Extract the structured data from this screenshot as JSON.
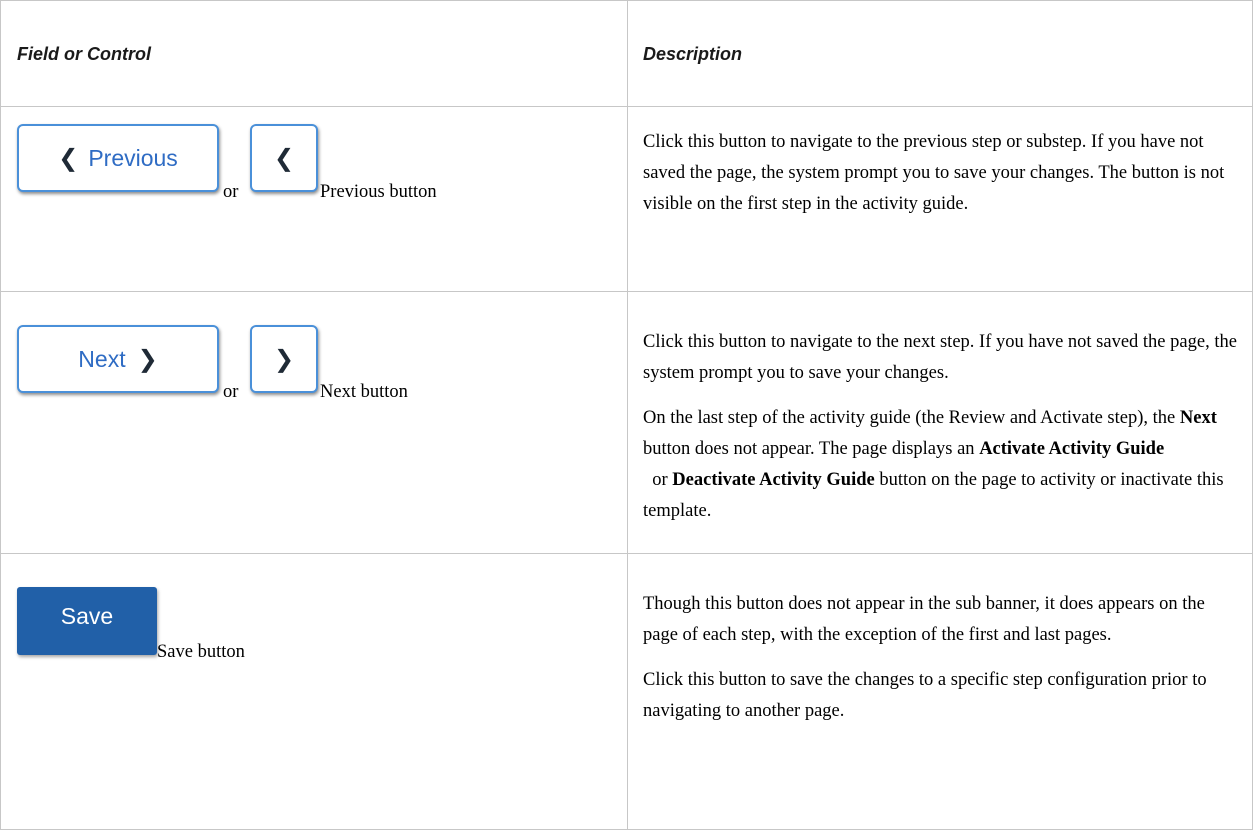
{
  "table": {
    "header": {
      "field": "Field or Control",
      "description": "Description"
    },
    "rows": [
      {
        "button_wide_label": "Previous",
        "separator": "or",
        "caption": "Previous button",
        "description": [
          "Click this button to navigate to the previous step or substep. If you have not saved the page, the system prompt you to save your changes. The button is not visible on the first step in the activity guide."
        ]
      },
      {
        "button_wide_label": "Next",
        "separator": "or",
        "caption": "Next button",
        "description": [
          "Click this button to navigate to the next step. If you have not saved the page, the system prompt you to save your changes."
        ],
        "desc2": {
          "part1": "On the last step of the activity guide (the Review and Activate step), the ",
          "bold1": "Next",
          "part2": " button does not appear. The page displays an ",
          "bold2": "Activate Activity Guide",
          "part3": "  or ",
          "bold3": "Deactivate Activity Guide",
          "part4": " button on the page to activity or inactivate this template."
        }
      },
      {
        "button_label": "Save",
        "caption": "Save button",
        "description": [
          "Though this button does not appear in the sub banner, it does appears on the page of each step, with the exception of the first and last pages.",
          "Click this button to save the changes to a specific step configuration prior to navigating to another page."
        ]
      }
    ]
  },
  "icons": {
    "prev": "chevron-left-icon",
    "next": "chevron-right-icon"
  },
  "colors": {
    "border": "#c7c7c7",
    "button_outline": "#4a90d9",
    "button_text_blue": "#2f6cc4",
    "save_button_bg": "#2160a8"
  }
}
